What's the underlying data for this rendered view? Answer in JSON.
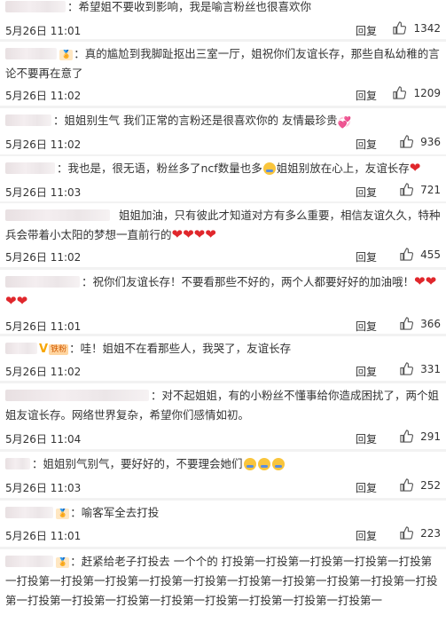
{
  "labels": {
    "reply": "回复"
  },
  "colors": {
    "heart": "#e0272c",
    "background": "#f2f2f2",
    "card": "#ffffff"
  },
  "comments": [
    {
      "text": "：希望姐不要收到影响，我是喻言粉丝也很喜欢你",
      "date": "5月26日 11:01",
      "likes": "1342"
    },
    {
      "text": "：真的尴尬到我脚趾抠出三室一厅，姐祝你们友谊长存，那些自私幼稚的言论不要再在意了",
      "date": "5月26日 11:02",
      "likes": "1209"
    },
    {
      "text": "：姐姐别生气 我们正常的言粉还是很喜欢你的 友情最珍贵",
      "date": "5月26日 11:02",
      "likes": "936"
    },
    {
      "text": "：我也是，很无语，粉丝多了ncf数量也多",
      "text2": "姐姐别放在心上，友谊长存",
      "date": "5月26日 11:03",
      "likes": "721"
    },
    {
      "text": "姐姐加油，只有彼此才知道对方有多么重要，相信友谊久久，特种兵会带着小太阳的梦想一直前行的",
      "date": "5月26日 11:02",
      "likes": "455"
    },
    {
      "text": "：祝你们友谊长存！不要看那些不好的，两个人都要好好的加油哦！",
      "date": "5月26日 11:01",
      "likes": "366"
    },
    {
      "text": "：哇！姐姐不在看那些人，我哭了，友谊长存",
      "badge": "铁粉",
      "date": "5月26日 11:02",
      "likes": "331"
    },
    {
      "text": "：对不起姐姐，有的小粉丝不懂事给你造成困扰了，两个姐姐友谊长存。网络世界复杂，希望你们感情如初。",
      "date": "5月26日 11:04",
      "likes": "291"
    },
    {
      "text": "：姐姐别气别气，要好好的，不要理会她们",
      "date": "5月26日 11:03",
      "likes": "252"
    },
    {
      "text": "：喻客军全去打投",
      "date": "5月26日 11:01",
      "likes": "223"
    },
    {
      "text": "：赶紧给老子打投去 一个个的 打投第一打投第一打投第一打投第一打投第一打投第一打投第一打投第一打投第一打投第一打投第一打投第一打投第一打投第一打投第一打投第一打投第一打投第一打投第一打投第一打投第一打投第一打投第一"
    }
  ]
}
